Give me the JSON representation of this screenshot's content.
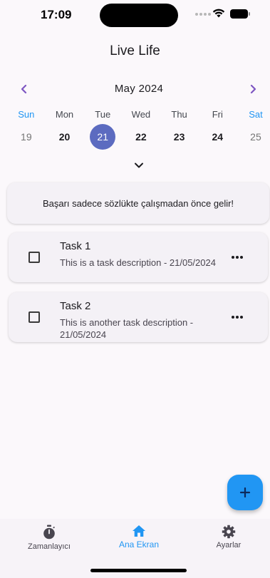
{
  "status_bar": {
    "time": "17:09"
  },
  "app_title": "Live Life",
  "calendar": {
    "month_label": "May 2024",
    "days": [
      {
        "dow": "Sun",
        "date": "19",
        "weekend": true,
        "state": "muted"
      },
      {
        "dow": "Mon",
        "date": "20",
        "weekend": false,
        "state": "normal"
      },
      {
        "dow": "Tue",
        "date": "21",
        "weekend": false,
        "state": "selected"
      },
      {
        "dow": "Wed",
        "date": "22",
        "weekend": false,
        "state": "normal"
      },
      {
        "dow": "Thu",
        "date": "23",
        "weekend": false,
        "state": "normal"
      },
      {
        "dow": "Fri",
        "date": "24",
        "weekend": false,
        "state": "normal"
      },
      {
        "dow": "Sat",
        "date": "25",
        "weekend": true,
        "state": "muted"
      }
    ]
  },
  "quote": "Başarı sadece sözlükte çalışmadan önce gelir!",
  "tasks": [
    {
      "title": "Task 1",
      "description": "This is a task description - 21/05/2024"
    },
    {
      "title": "Task 2",
      "description": "This is another task description - 21/05/2024"
    }
  ],
  "fab": {
    "icon": "plus-icon"
  },
  "bottom_nav": {
    "items": [
      {
        "label": "Zamanlayıcı",
        "icon": "stopwatch-icon",
        "active": false
      },
      {
        "label": "Ana Ekran",
        "icon": "home-icon",
        "active": true
      },
      {
        "label": "Ayarlar",
        "icon": "gear-icon",
        "active": false
      }
    ]
  },
  "colors": {
    "accent": "#2196f3",
    "selected_date": "#5c6bc0",
    "nav_chevron": "#7e57c2",
    "background": "#fbf8fb",
    "card": "#f4f1f6"
  }
}
